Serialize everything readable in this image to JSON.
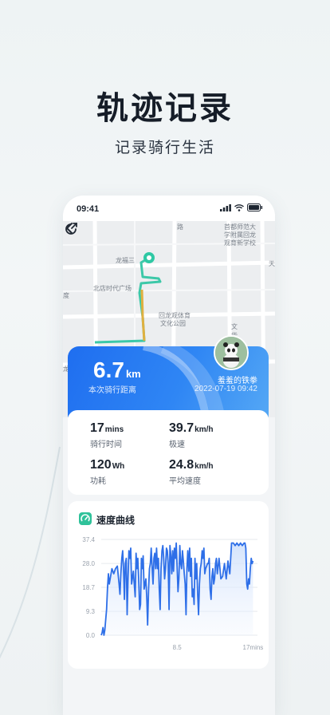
{
  "hero": {
    "title": "轨迹记录",
    "subtitle": "记录骑行生活"
  },
  "status": {
    "time": "09:41"
  },
  "map": {
    "labels": [
      "路",
      "首都师范大",
      "学附属回龙",
      "观育新学校",
      "龙福三",
      "北店时代广场",
      "度",
      "回龙观体育",
      "文化公园",
      "文",
      "华",
      "天",
      "龙"
    ]
  },
  "ride": {
    "distance_value": "6.7",
    "distance_unit": "km",
    "distance_label": "本次骑行距离",
    "user_name": "羞羞的铁拳",
    "datetime": "2022-07-19 09:42"
  },
  "stats": [
    {
      "value": "17",
      "unit": "mins",
      "label": "骑行时间"
    },
    {
      "value": "39.7",
      "unit": "km/h",
      "label": "极速"
    },
    {
      "value": "120",
      "unit": "Wh",
      "label": "功耗"
    },
    {
      "value": "24.8",
      "unit": "km/h",
      "label": "平均速度"
    }
  ],
  "chart_title": "速度曲线",
  "chart_data": {
    "type": "area",
    "title": "速度曲线",
    "xlabel": "",
    "ylabel": "",
    "x_tick_labels": [
      "8.5",
      "17mins"
    ],
    "x_ticks": [
      8.5,
      17
    ],
    "xlim": [
      0,
      17.5
    ],
    "y_ticks": [
      0.0,
      9.3,
      18.7,
      28.0,
      37.4
    ],
    "y_tick_labels": [
      "0.0",
      "9.3",
      "18.7",
      "28.0",
      "37.4"
    ],
    "ylim": [
      0,
      37.4
    ],
    "grid": true,
    "color": "#2e6fe8",
    "x": [
      0.0,
      0.1,
      0.2,
      0.3,
      0.4,
      0.5,
      0.6,
      0.7,
      0.8,
      0.9,
      1.0,
      1.2,
      1.4,
      1.5,
      1.6,
      1.8,
      2.0,
      2.1,
      2.2,
      2.3,
      2.4,
      2.5,
      2.6,
      2.7,
      2.8,
      2.9,
      3.0,
      3.1,
      3.2,
      3.3,
      3.4,
      3.6,
      3.8,
      3.9,
      4.0,
      4.1,
      4.2,
      4.3,
      4.4,
      4.5,
      4.6,
      4.7,
      4.8,
      4.9,
      5.0,
      5.1,
      5.2,
      5.3,
      5.4,
      5.5,
      5.6,
      5.7,
      5.8,
      5.9,
      6.0,
      6.1,
      6.2,
      6.3,
      6.4,
      6.5,
      6.6,
      6.7,
      6.8,
      6.9,
      7.0,
      7.1,
      7.2,
      7.3,
      7.4,
      7.5,
      7.6,
      7.7,
      7.8,
      7.9,
      8.0,
      8.1,
      8.2,
      8.3,
      8.4,
      8.5,
      8.6,
      8.7,
      8.8,
      8.9,
      9.0,
      9.1,
      9.2,
      9.3,
      9.4,
      9.5,
      9.6,
      9.7,
      9.8,
      9.9,
      10.0,
      10.1,
      10.2,
      10.3,
      10.4,
      10.5,
      10.6,
      10.7,
      10.8,
      10.9,
      11.0,
      11.1,
      11.2,
      11.3,
      11.4,
      11.5,
      11.6,
      11.7,
      11.8,
      11.9,
      12.0,
      12.1,
      12.2,
      12.3,
      12.4,
      12.5,
      12.6,
      12.7,
      12.8,
      12.9,
      13.0,
      13.2,
      13.4,
      13.6,
      13.8,
      14.0,
      14.2,
      14.4,
      14.6,
      14.8,
      15.0,
      15.2,
      15.4,
      15.6,
      15.8,
      16.0,
      16.1,
      16.2,
      16.3,
      16.4,
      16.5,
      16.6,
      16.7,
      16.8,
      16.9,
      17.0
    ],
    "y": [
      0,
      1,
      3,
      0,
      2,
      6,
      10,
      18,
      24,
      20,
      22,
      26,
      24,
      25,
      26,
      27,
      20,
      16,
      24,
      30,
      33,
      26,
      14,
      28,
      30,
      8,
      22,
      33,
      30,
      34,
      20,
      25,
      15,
      32,
      26,
      30,
      22,
      10,
      12,
      30,
      26,
      31,
      18,
      20,
      22,
      15,
      4,
      18,
      26,
      28,
      34,
      27,
      20,
      30,
      32,
      26,
      34,
      26,
      30,
      18,
      10,
      26,
      33,
      35,
      30,
      22,
      26,
      34,
      33,
      28,
      10,
      35,
      31,
      24,
      33,
      25,
      34,
      30,
      36,
      27,
      17,
      22,
      35,
      28,
      26,
      33,
      29,
      24,
      20,
      8,
      26,
      33,
      25,
      34,
      23,
      30,
      15,
      18,
      12,
      30,
      22,
      28,
      16,
      8,
      20,
      26,
      28,
      33,
      30,
      34,
      24,
      26,
      27,
      28,
      28,
      30,
      18,
      14,
      23,
      26,
      20,
      22,
      28,
      30,
      24,
      30,
      22,
      23,
      28,
      22,
      29,
      24,
      36,
      36,
      35,
      36,
      35,
      36,
      35,
      36,
      36,
      34,
      20,
      18,
      22,
      20,
      26,
      30,
      28,
      29
    ]
  }
}
